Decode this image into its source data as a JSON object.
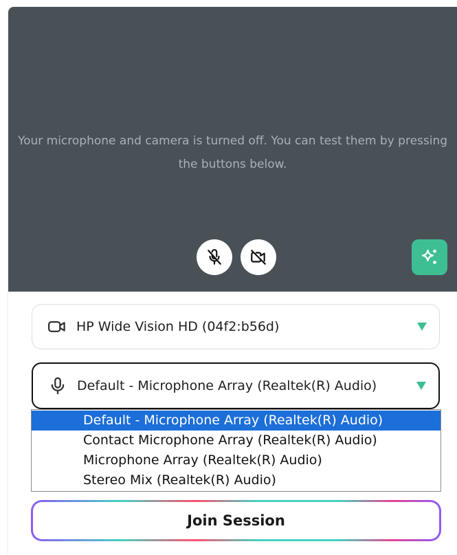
{
  "preview": {
    "message": "Your microphone and camera is turned off. You can test them by pressing the buttons below."
  },
  "controls": {
    "mic_icon": "mic-off-icon",
    "camera_icon": "camera-off-icon",
    "effects_icon": "sparkles-icon"
  },
  "camera_select": {
    "icon": "video-camera-icon",
    "value": "HP Wide Vision HD (04f2:b56d)"
  },
  "mic_select": {
    "icon": "microphone-icon",
    "value": "Default - Microphone Array  (Realtek(R) Audio)",
    "options": [
      "Default - Microphone Array  (Realtek(R) Audio)",
      "Contact Microphone Array (Realtek(R) Audio)",
      "Microphone Array (Realtek(R) Audio)",
      "Stereo Mix (Realtek(R) Audio)"
    ],
    "selected_index": 0
  },
  "join": {
    "label": "Join Session"
  },
  "colors": {
    "preview_bg": "#495157",
    "accent": "#3ebf93",
    "selected_option": "#1c6ed8"
  }
}
